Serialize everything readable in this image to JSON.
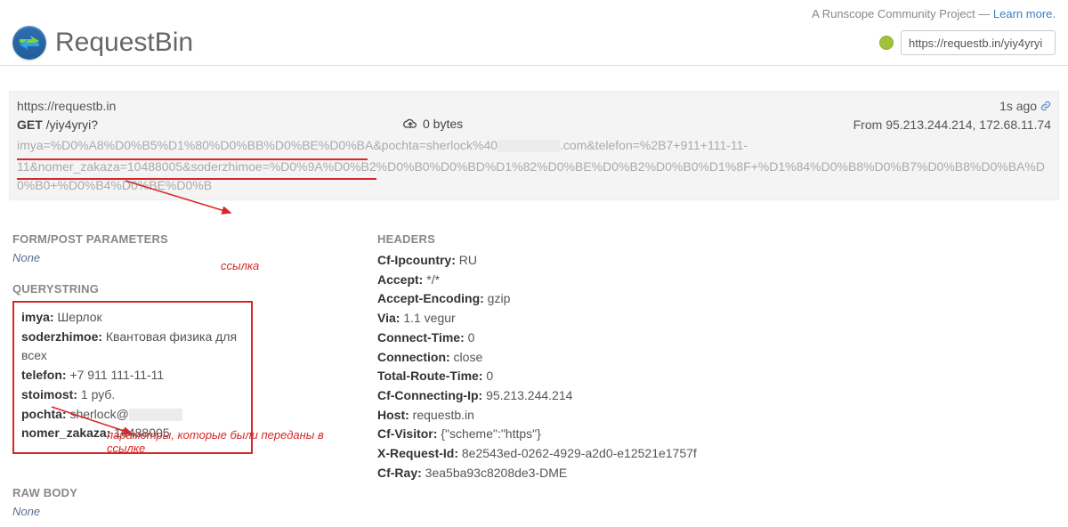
{
  "topbar": {
    "prefix": "A Runscope Community Project — ",
    "link": "Learn more."
  },
  "brand": "RequestBin",
  "url_input": "https://requestb.in/yiy4yryi",
  "request": {
    "host": "https://requestb.in",
    "method": "GET",
    "path": "/yiy4yryi?",
    "bytes": "0 bytes",
    "age": "1s ago",
    "from_label": "From ",
    "from_ips": "95.213.244.214, 172.68.11.74",
    "query1": "imya=%D0%A8%D0%B5%D1%80%D0%BB%D0%BE%D0%BA&pochta=sherlock%40",
    "query1b": ".com&telefon=%2B7+911+111-11-",
    "query2": "11&nomer_zakaza=10488005&soderzhimoe=%D0%9A%D0%B2%D0%B0%D0%BD%D1%82%D0%BE%D0%B2%D0%B0%D1%8F+%D1%84%D0%B8%D0%B7%D0%B8%D0%BA%D0%B0+%D0%B4%D0%BE%D0%B"
  },
  "sections": {
    "form_post": "FORM/POST PARAMETERS",
    "none": "None",
    "querystring": "QUERYSTRING",
    "headers": "HEADERS",
    "raw_body": "RAW BODY"
  },
  "qs": {
    "imya_k": "imya:",
    "imya_v": " Шерлок",
    "soderzhimoe_k": "soderzhimoe:",
    "soderzhimoe_v": " Квантовая физика для всех",
    "telefon_k": "telefon:",
    "telefon_v": " +7 911 111-11-11",
    "stoimost_k": "stoimost:",
    "stoimost_v": " 1 руб.",
    "pochta_k": "pochta:",
    "pochta_v": " sherlock@",
    "nomer_k": "nomer_zakaza:",
    "nomer_v": " 10488005"
  },
  "headers": {
    "h1k": "Cf-Ipcountry:",
    "h1v": " RU",
    "h2k": "Accept:",
    "h2v": " */*",
    "h3k": "Accept-Encoding:",
    "h3v": " gzip",
    "h4k": "Via:",
    "h4v": " 1.1 vegur",
    "h5k": "Connect-Time:",
    "h5v": " 0",
    "h6k": "Connection:",
    "h6v": " close",
    "h7k": "Total-Route-Time:",
    "h7v": " 0",
    "h8k": "Cf-Connecting-Ip:",
    "h8v": " 95.213.244.214",
    "h9k": "Host:",
    "h9v": " requestb.in",
    "h10k": "Cf-Visitor:",
    "h10v": " {\"scheme\":\"https\"}",
    "h11k": "X-Request-Id:",
    "h11v": " 8e2543ed-0262-4929-a2d0-e12521e1757f",
    "h12k": "Cf-Ray:",
    "h12v": " 3ea5ba93c8208de3-DME"
  },
  "annotations": {
    "link": "ссылка",
    "params": "параметры, которые были переданы в ссылке"
  }
}
